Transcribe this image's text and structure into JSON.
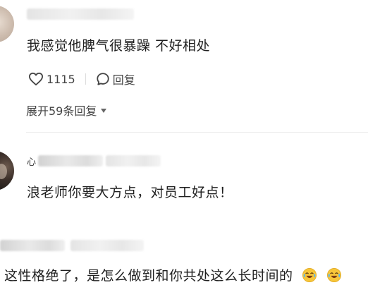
{
  "comments": [
    {
      "text": "我感觉他脾气很暴躁 不好相处",
      "likes": "1115",
      "reply_label": "回复",
      "expand_label": "展开59条回复"
    },
    {
      "name_prefix": "心",
      "text": "浪老师你要大方点，对员工好点！"
    },
    {
      "text": "这性格绝了，是怎么做到和你共处这么长时间的",
      "emojis": [
        "crying-laughing-emoji",
        "crying-laughing-emoji"
      ]
    }
  ],
  "colors": {
    "text": "#1f1f1f",
    "secondary": "#444444",
    "divider": "#ececec"
  }
}
